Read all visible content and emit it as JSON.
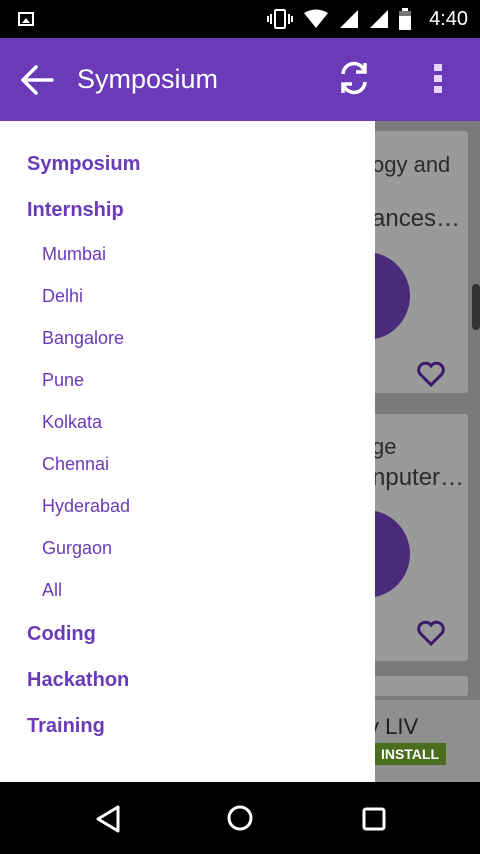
{
  "status_bar": {
    "time": "4:40",
    "icons": [
      "image-icon",
      "vibrate-icon",
      "wifi-icon",
      "signal-icon",
      "signal-icon",
      "battery-icon"
    ]
  },
  "app_bar": {
    "title": "Symposium",
    "icons": [
      "back-arrow-icon",
      "refresh-icon",
      "more-vert-icon"
    ],
    "color": "#6a3ab8"
  },
  "drawer": {
    "items": [
      {
        "label": "Symposium",
        "level": "main"
      },
      {
        "label": "Internship",
        "level": "main"
      },
      {
        "label": "Mumbai",
        "level": "sub"
      },
      {
        "label": "Delhi",
        "level": "sub"
      },
      {
        "label": "Bangalore",
        "level": "sub"
      },
      {
        "label": "Pune",
        "level": "sub"
      },
      {
        "label": "Kolkata",
        "level": "sub"
      },
      {
        "label": "Chennai",
        "level": "sub"
      },
      {
        "label": "Hyderabad",
        "level": "sub"
      },
      {
        "label": "Gurgaon",
        "level": "sub"
      },
      {
        "label": "All",
        "level": "sub"
      },
      {
        "label": "Coding",
        "level": "main"
      },
      {
        "label": "Hackathon",
        "level": "main"
      },
      {
        "label": "Training",
        "level": "main"
      }
    ]
  },
  "background": {
    "cards": [
      {
        "line1": "ogy and",
        "line2": "ances…"
      },
      {
        "line1": "ge",
        "line2": "nputer…"
      }
    ],
    "ad": {
      "text": "y LIV",
      "button": "INSTALL"
    }
  }
}
